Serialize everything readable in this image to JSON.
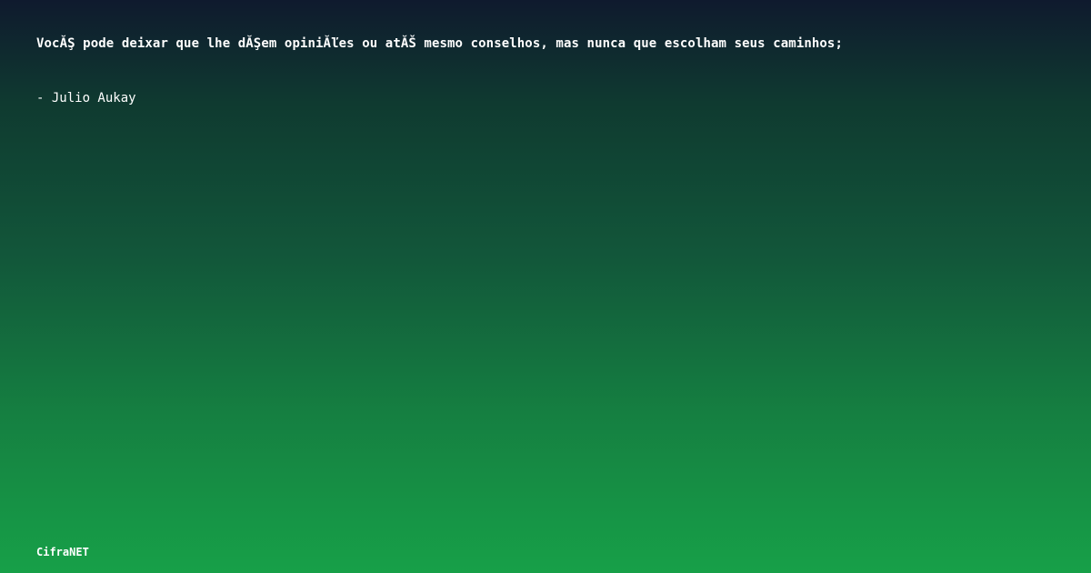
{
  "quote": {
    "text": "VocĂŞ pode deixar que lhe dĂŞem opiniĂľes ou atĂŠ mesmo conselhos, mas nunca que escolham seus caminhos;",
    "author": "- Julio Aukay"
  },
  "brand": {
    "name": "CifraNET"
  },
  "colors": {
    "gradient_top": "#0f1a2e",
    "gradient_bottom": "#17a048",
    "text": "#ffffff"
  }
}
